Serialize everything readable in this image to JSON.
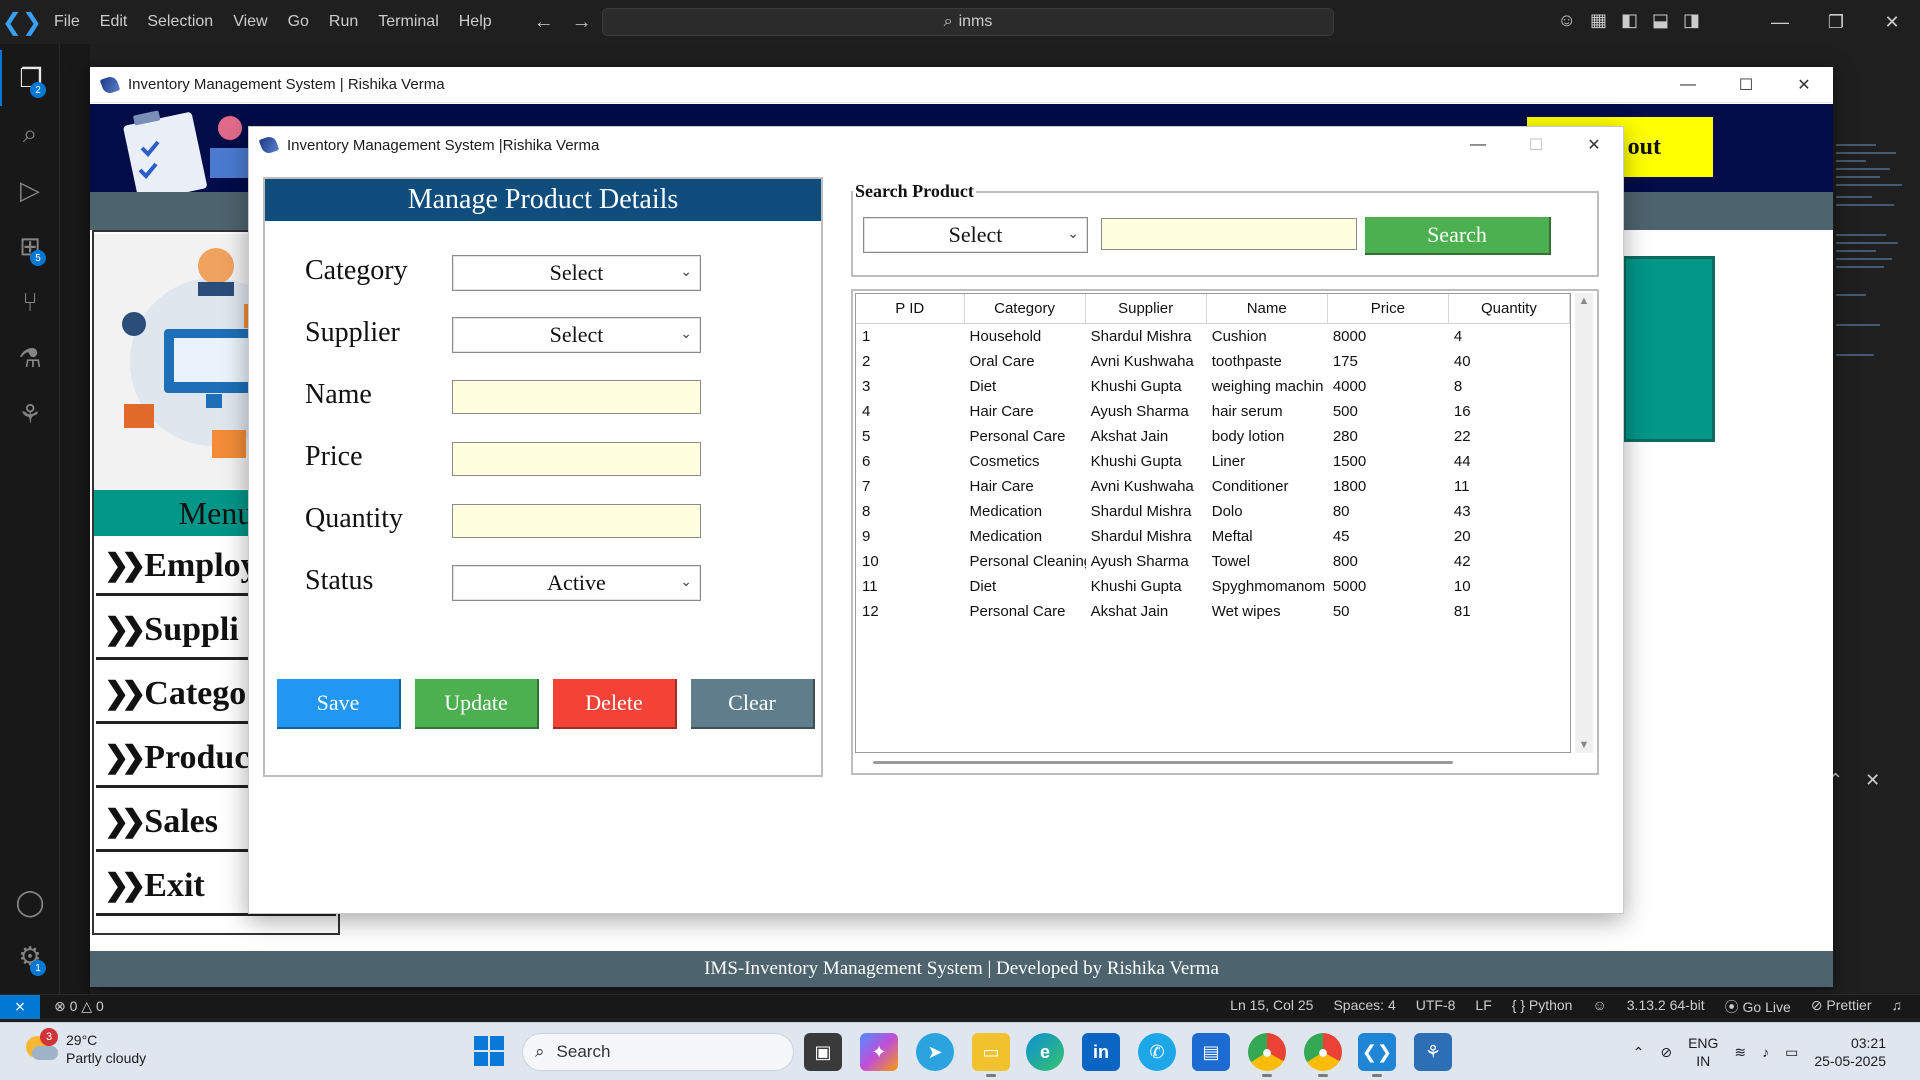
{
  "vscode": {
    "menu": [
      "File",
      "Edit",
      "Selection",
      "View",
      "Go",
      "Run",
      "Terminal",
      "Help"
    ],
    "command_center": "inms",
    "activity_badges": {
      "explorer": "2",
      "extensions": "5",
      "settings": "1"
    },
    "status": {
      "errors": "0",
      "warnings": "0",
      "position": "Ln 15, Col 25",
      "spaces": "Spaces: 4",
      "encoding": "UTF-8",
      "eol": "LF",
      "language": "{ } Python",
      "interpreter": "3.13.2 64-bit",
      "golive": "Go Live",
      "prettier": "Prettier"
    }
  },
  "dashboard": {
    "window_title": "Inventory Management System | Rishika Verma",
    "logout_label": "out",
    "menu_header": "Menu",
    "menu_items": [
      "Employ",
      "Suppli",
      "Catego",
      "Produc",
      "Sales",
      "Exit"
    ],
    "footer": "IMS-Inventory Management System | Developed by Rishika Verma"
  },
  "product_window": {
    "title": "Inventory Management System |Rishika Verma",
    "form": {
      "heading": "Manage Product Details",
      "labels": {
        "category": "Category",
        "supplier": "Supplier",
        "name": "Name",
        "price": "Price",
        "quantity": "Quantity",
        "status": "Status"
      },
      "category_value": "Select",
      "supplier_value": "Select",
      "status_value": "Active",
      "buttons": {
        "save": "Save",
        "update": "Update",
        "delete": "Delete",
        "clear": "Clear"
      }
    },
    "search": {
      "legend": "Search Product",
      "by_value": "Select",
      "button": "Search"
    },
    "table": {
      "columns": [
        "P ID",
        "Category",
        "Supplier",
        "Name",
        "Price",
        "Quantity"
      ],
      "rows": [
        [
          "1",
          "Household",
          "Shardul Mishra",
          "Cushion",
          "8000",
          "4"
        ],
        [
          "2",
          "Oral Care",
          "Avni Kushwaha",
          "toothpaste",
          "175",
          "40"
        ],
        [
          "3",
          "Diet",
          "Khushi Gupta",
          "weighing machin",
          "4000",
          "8"
        ],
        [
          "4",
          "Hair Care",
          "Ayush Sharma",
          "hair serum",
          "500",
          "16"
        ],
        [
          "5",
          "Personal Care",
          "Akshat Jain",
          "body lotion",
          "280",
          "22"
        ],
        [
          "6",
          "Cosmetics",
          "Khushi Gupta",
          "Liner",
          "1500",
          "44"
        ],
        [
          "7",
          "Hair Care",
          "Avni Kushwaha",
          "Conditioner",
          "1800",
          "11"
        ],
        [
          "8",
          "Medication",
          "Shardul Mishra",
          "Dolo",
          "80",
          "43"
        ],
        [
          "9",
          "Medication",
          "Shardul Mishra",
          "Meftal",
          "45",
          "20"
        ],
        [
          "10",
          "Personal Cleaning",
          "Ayush Sharma",
          "Towel",
          "800",
          "42"
        ],
        [
          "11",
          "Diet",
          "Khushi Gupta",
          "Spyghmomanom",
          "5000",
          "10"
        ],
        [
          "12",
          "Personal Care",
          "Akshat Jain",
          "Wet wipes",
          "50",
          "81"
        ]
      ]
    }
  },
  "taskbar": {
    "weather_temp": "29°C",
    "weather_desc": "Partly cloudy",
    "weather_badge": "3",
    "search_label": "Search",
    "lang_top": "ENG",
    "lang_bottom": "IN",
    "time": "03:21",
    "date": "25-05-2025"
  },
  "colors": {
    "form_header": "#0f4d7d",
    "save": "#2196f3",
    "update": "#4caf50",
    "delete": "#f44336",
    "clear": "#607d8b",
    "search": "#4caf50",
    "entry_bg": "#ffffe0",
    "dash_header": "#010c48",
    "logout": "#ffff00",
    "menu_teal": "#009688",
    "subbar": "#4d636d"
  }
}
